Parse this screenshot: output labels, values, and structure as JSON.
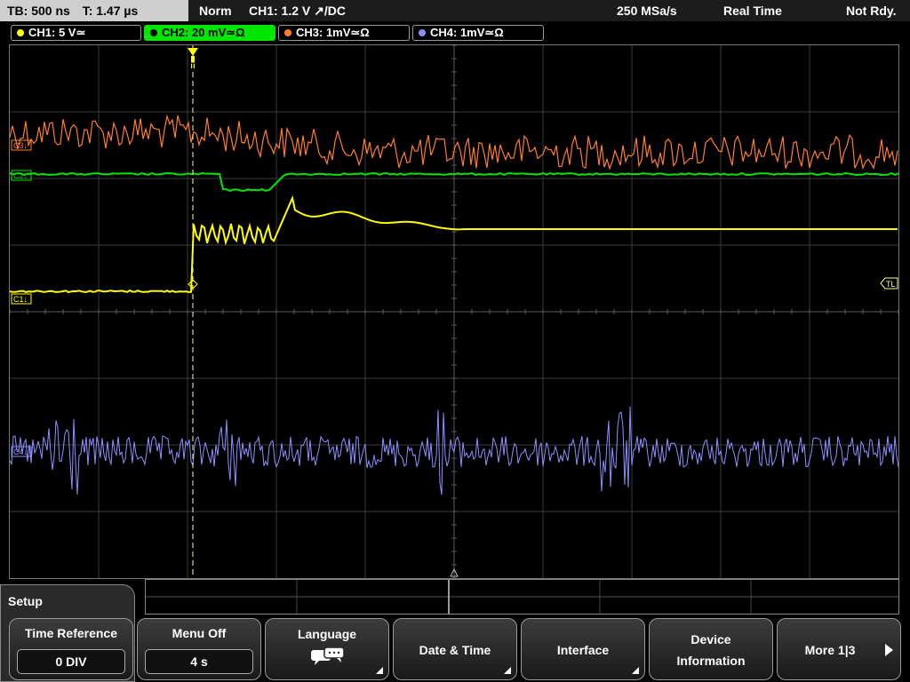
{
  "status": {
    "timebase": "TB: 500 ns",
    "time": "T: 1.47 µs",
    "mode": "Norm",
    "trigger": "CH1: 1.2 V ↗/DC",
    "sample_rate": "250 MSa/s",
    "acquisition": "Real Time",
    "state": "Not Rdy."
  },
  "channels": [
    {
      "label": "CH1: 5 V≃",
      "color": "#ffff00"
    },
    {
      "label": "CH2: 20 mV≃Ω",
      "color": "#00e600",
      "active": true
    },
    {
      "label": "CH3: 1mV≃Ω",
      "color": "#ff7f27"
    },
    {
      "label": "CH4: 1mV≃Ω",
      "color": "#8f8fff"
    }
  ],
  "markers": {
    "c1": "C1↓",
    "c2": "C2↓",
    "c3": "C3↓",
    "c4": "C4↓",
    "trigger_level": "TL",
    "trigger_pos": "T"
  },
  "setup": {
    "title": "Setup"
  },
  "softkeys": {
    "time_reference": {
      "label": "Time Reference",
      "value": "0 DIV"
    },
    "menu_off": {
      "label": "Menu Off",
      "value": "4 s"
    },
    "language": {
      "label": "Language",
      "icon": "speech-bubbles-icon"
    },
    "date_time": {
      "label": "Date & Time"
    },
    "interface": {
      "label": "Interface"
    },
    "device_info": {
      "line1": "Device",
      "line2": "Information"
    },
    "more": {
      "label": "More 1|3"
    }
  },
  "colors": {
    "ch1": "#ffff00",
    "ch2": "#00e600",
    "ch3": "#ff7f27",
    "ch4": "#8f8fff",
    "grid": "#404040"
  }
}
